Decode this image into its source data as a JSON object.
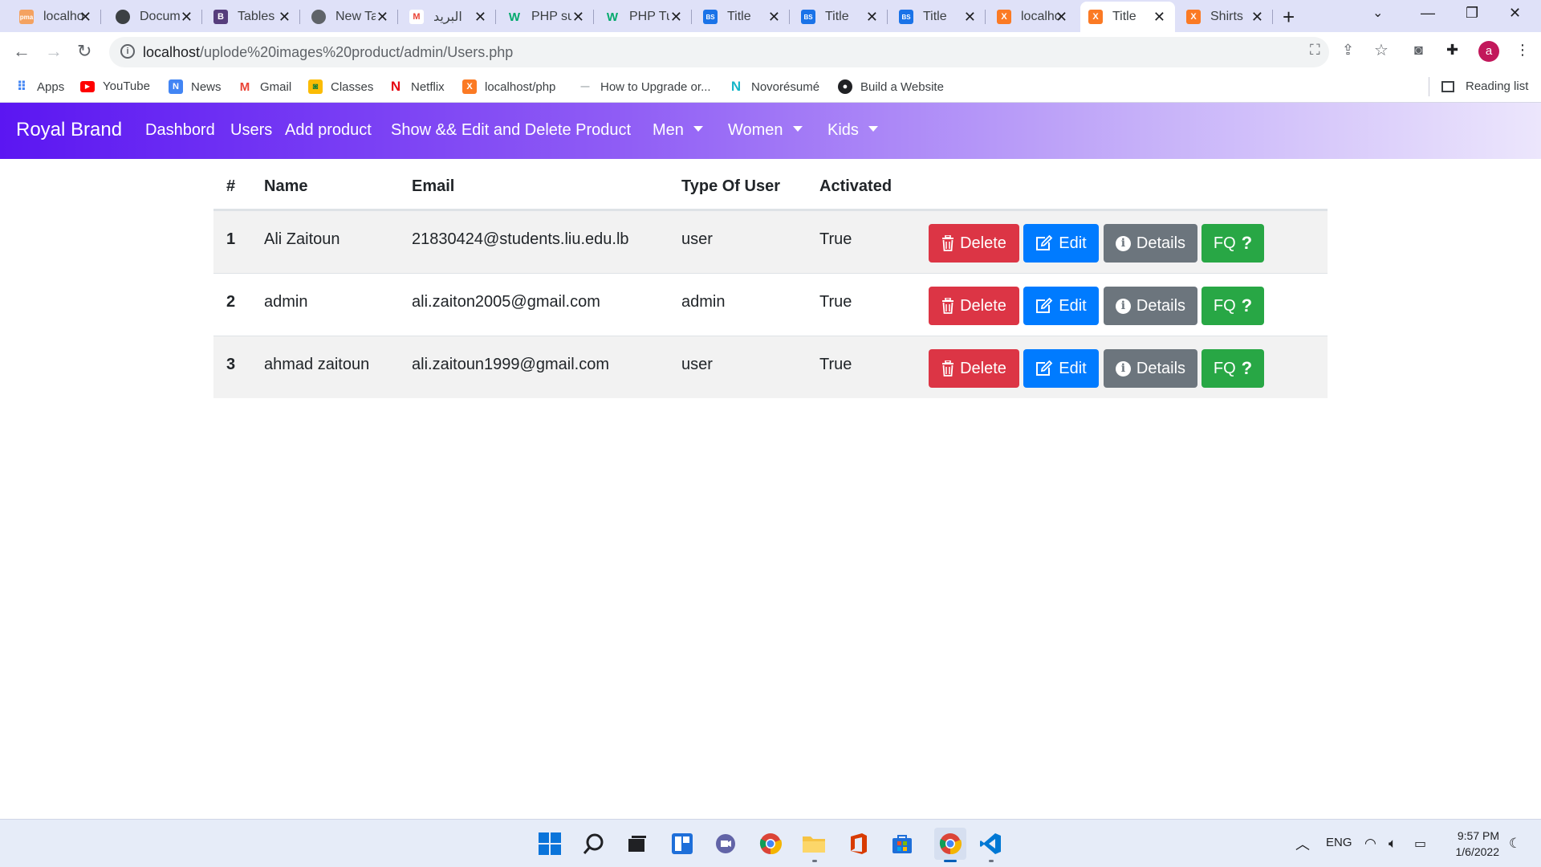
{
  "browser": {
    "tabs": [
      {
        "label": "localhost",
        "fav_color": "#f4a261",
        "fav_text": "pma"
      },
      {
        "label": "Document",
        "fav_color": "#3c4043",
        "fav_text": ""
      },
      {
        "label": "Tables",
        "fav_color": "#563d7c",
        "fav_text": "B"
      },
      {
        "label": "New Tab",
        "fav_color": "#5f6368",
        "fav_text": ""
      },
      {
        "label": "البريد",
        "fav_color": "#ffffff",
        "fav_text": "M"
      },
      {
        "label": "PHP su",
        "fav_color": "#04aa6d",
        "fav_text": "W"
      },
      {
        "label": "PHP Tu",
        "fav_color": "#04aa6d",
        "fav_text": "W"
      },
      {
        "label": "Title",
        "fav_color": "#1a73e8",
        "fav_text": "BS"
      },
      {
        "label": "Title",
        "fav_color": "#1a73e8",
        "fav_text": "BS"
      },
      {
        "label": "Title",
        "fav_color": "#1a73e8",
        "fav_text": "BS"
      },
      {
        "label": "localhost",
        "fav_color": "#fb7a24",
        "fav_text": "X"
      },
      {
        "label": "Title",
        "fav_color": "#fb7a24",
        "fav_text": "X"
      },
      {
        "label": "Shirts",
        "fav_color": "#fb7a24",
        "fav_text": "X"
      }
    ],
    "url_host": "localhost",
    "url_path": "/uplode%20images%20product/admin/Users.php",
    "avatar_letter": "a",
    "bookmarks": [
      {
        "label": "Apps",
        "color": "#4285f4"
      },
      {
        "label": "YouTube",
        "color": "#ff0000"
      },
      {
        "label": "News",
        "color": "#4285f4"
      },
      {
        "label": "Gmail",
        "color": "#ea4335"
      },
      {
        "label": "Classes",
        "color": "#fbbc04"
      },
      {
        "label": "Netflix",
        "color": "#e50914"
      },
      {
        "label": "localhost/php",
        "color": "#fb7a24"
      },
      {
        "label": "How to Upgrade or...",
        "color": "#9aa0a6"
      },
      {
        "label": "Novorésumé",
        "color": "#17b6c8"
      },
      {
        "label": "Build a Website",
        "color": "#202124"
      }
    ],
    "reading_list": "Reading list"
  },
  "navbar": {
    "brand": "Royal Brand",
    "links": [
      "Dashbord",
      "Users",
      "Add product",
      "Show && Edit and Delete Product"
    ],
    "dropdowns": [
      "Men",
      "Women",
      "Kids"
    ]
  },
  "table": {
    "headers": [
      "#",
      "Name",
      "Email",
      "Type Of User",
      "Activated"
    ],
    "rows": [
      {
        "num": "1",
        "name": "Ali Zaitoun",
        "email": "21830424@students.liu.edu.lb",
        "type": "user",
        "activated": "True"
      },
      {
        "num": "2",
        "name": "admin",
        "email": "ali.zaiton2005@gmail.com",
        "type": "admin",
        "activated": "True"
      },
      {
        "num": "3",
        "name": "ahmad zaitoun",
        "email": "ali.zaitoun1999@gmail.com",
        "type": "user",
        "activated": "True"
      }
    ],
    "actions": {
      "delete": "Delete",
      "edit": "Edit",
      "details": "Details",
      "fq": "FQ"
    },
    "colors": {
      "delete": "#dc3545",
      "edit": "#007bff",
      "details": "#6c757d",
      "fq": "#28a745"
    }
  },
  "taskbar": {
    "language": "ENG",
    "time": "9:57 PM",
    "date": "1/6/2022"
  }
}
